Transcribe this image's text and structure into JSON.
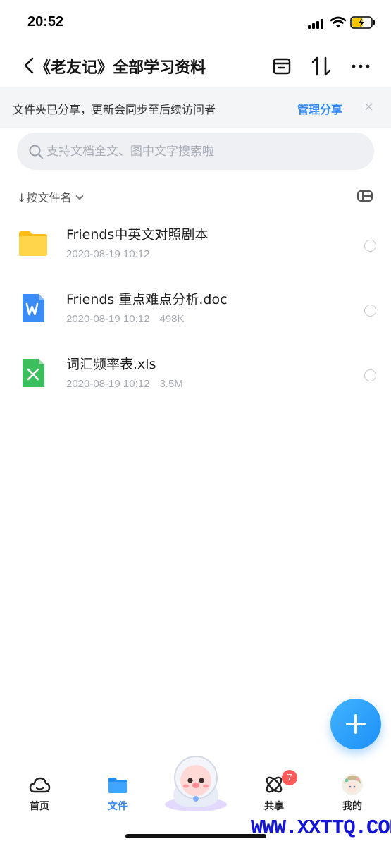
{
  "status_bar": {
    "time": "20:52"
  },
  "header": {
    "title": "<《老友记》全部学习资料",
    "title_text": "《老友记》全部学习资料"
  },
  "share_notice": {
    "text": "文件夹已分享，更新会同步至后续访问者",
    "action": "管理分享",
    "close": "×"
  },
  "search": {
    "placeholder": "支持文档全文、图中文字搜索啦"
  },
  "sort": {
    "label": "↓按文件名"
  },
  "files": [
    {
      "name": "Friends中英文对照剧本",
      "date": "2020-08-19 10:12",
      "size": "",
      "icon": "folder-icon",
      "color": "#ffc727"
    },
    {
      "name": "Friends 重点难点分析.doc",
      "date": "2020-08-19 10:12",
      "size": "498K",
      "icon": "word-doc-icon",
      "color": "#3a8cf6"
    },
    {
      "name": "词汇频率表.xls",
      "date": "2020-08-19 10:12",
      "size": "3.5M",
      "icon": "excel-xls-icon",
      "color": "#3bbf5c"
    }
  ],
  "tabs": [
    {
      "label": "首页",
      "icon": "cloud-home-icon",
      "active": false
    },
    {
      "label": "文件",
      "icon": "folder-icon",
      "active": true
    },
    {
      "label": "共享",
      "icon": "atom-share-icon",
      "active": false,
      "badge": "7"
    },
    {
      "label": "我的",
      "icon": "avatar-icon",
      "active": false
    }
  ],
  "accent_color": "#2f86f6",
  "watermark": "WWW.XXTTQ.COM"
}
